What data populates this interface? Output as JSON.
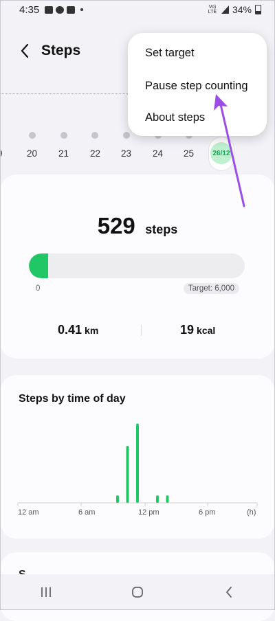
{
  "status_bar": {
    "time": "4:35",
    "network": "Vo) LTE",
    "battery": "34%"
  },
  "header": {
    "title": "Steps"
  },
  "week": {
    "days": [
      "9",
      "20",
      "21",
      "22",
      "23",
      "24",
      "25"
    ],
    "today": "26/12"
  },
  "summary": {
    "steps": "529",
    "steps_unit": "steps",
    "progress_fraction": 0.088,
    "progress_start": "0",
    "target": "Target: 6,000",
    "distance": "0.41",
    "distance_unit": "km",
    "calories": "19",
    "calories_unit": "kcal"
  },
  "chart": {
    "title": "Steps by time of day",
    "x_labels": [
      "12 am",
      "6 am",
      "12 pm",
      "6 pm",
      "(h)"
    ]
  },
  "chart_data": {
    "type": "bar",
    "title": "Steps by time of day",
    "xlabel": "",
    "ylabel": "",
    "x_unit": "h",
    "x": [
      10,
      11,
      12,
      14,
      15
    ],
    "values": [
      15,
      115,
      160,
      15,
      15
    ],
    "xlim": [
      0,
      24
    ],
    "grid": false
  },
  "bottom_card": {
    "text": "S"
  },
  "menu": {
    "items": [
      "Set target",
      "Pause step counting",
      "About steps"
    ]
  },
  "colors": {
    "accent": "#21c764",
    "annotation_arrow": "#9b4ee6"
  },
  "icons": {
    "back": "arrow-left",
    "recent": "recent-apps",
    "home": "home",
    "nav_back": "chevron-left"
  }
}
